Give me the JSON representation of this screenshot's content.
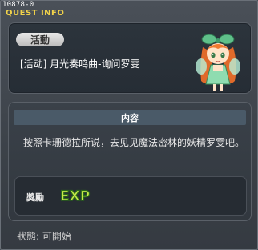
{
  "window": {
    "quest_id": "10878-0",
    "title": "QUEST INFO"
  },
  "quest": {
    "tag": "活動",
    "name": "[活动] 月光奏鸣曲-询问罗雯"
  },
  "content": {
    "header": "内容",
    "description": "按照卡珊德拉所说，去见见魔法密林的妖精罗雯吧。"
  },
  "reward": {
    "label": "獎勵",
    "exp_text": "EXP"
  },
  "status": {
    "text": "狀態:  可開始"
  },
  "colors": {
    "title": "#f2d34a",
    "exp_fill": "#c8e84a",
    "exp_stroke": "#2a6a1a"
  }
}
